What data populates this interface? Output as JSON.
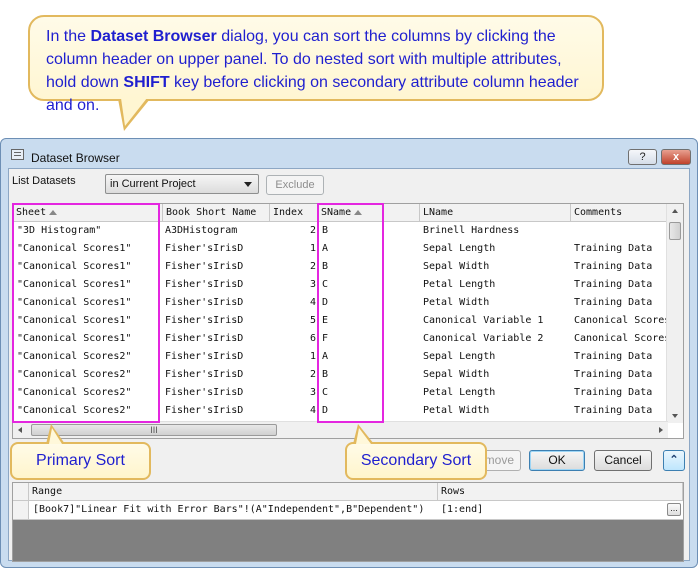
{
  "callout": {
    "t1": "In the ",
    "b1": "Dataset Browser",
    "t2": " dialog, you can sort the columns by clicking the column header on upper panel. To do nested sort with multiple attributes, hold down ",
    "b2": "SHIFT",
    "t3": " key before clicking on secondary attribute column header and on."
  },
  "window": {
    "title": "Dataset Browser",
    "help_label": "?",
    "close_label": "x"
  },
  "controls": {
    "list_datasets_label": "List Datasets",
    "scope_value": "in Current Project",
    "exclude_label": "Exclude"
  },
  "grid": {
    "columns": [
      "Sheet",
      "Book Short Name",
      "Index",
      "SName",
      "LName",
      "Comments"
    ],
    "rows": [
      [
        "\"3D Histogram\"",
        "A3DHistogram",
        "2",
        "B",
        "Brinell Hardness",
        ""
      ],
      [
        "\"Canonical Scores1\"",
        "Fisher'sIrisD",
        "1",
        "A",
        "Sepal Length",
        "Training Data"
      ],
      [
        "\"Canonical Scores1\"",
        "Fisher'sIrisD",
        "2",
        "B",
        "Sepal Width",
        "Training Data"
      ],
      [
        "\"Canonical Scores1\"",
        "Fisher'sIrisD",
        "3",
        "C",
        "Petal Length",
        "Training Data"
      ],
      [
        "\"Canonical Scores1\"",
        "Fisher'sIrisD",
        "4",
        "D",
        "Petal Width",
        "Training Data"
      ],
      [
        "\"Canonical Scores1\"",
        "Fisher'sIrisD",
        "5",
        "E",
        "Canonical Variable 1",
        "Canonical Scores"
      ],
      [
        "\"Canonical Scores1\"",
        "Fisher'sIrisD",
        "6",
        "F",
        "Canonical Variable 2",
        "Canonical Scores"
      ],
      [
        "\"Canonical Scores2\"",
        "Fisher'sIrisD",
        "1",
        "A",
        "Sepal Length",
        "Training Data"
      ],
      [
        "\"Canonical Scores2\"",
        "Fisher'sIrisD",
        "2",
        "B",
        "Sepal Width",
        "Training Data"
      ],
      [
        "\"Canonical Scores2\"",
        "Fisher'sIrisD",
        "3",
        "C",
        "Petal Length",
        "Training Data"
      ],
      [
        "\"Canonical Scores2\"",
        "Fisher'sIrisD",
        "4",
        "D",
        "Petal Width",
        "Training Data"
      ]
    ],
    "hscroll_grip": "III"
  },
  "buttons": {
    "remove_label": "move",
    "ok_label": "OK",
    "cancel_label": "Cancel",
    "expand_label": "⌃"
  },
  "lower_grid": {
    "columns": [
      "Range",
      "Rows"
    ],
    "row": {
      "range": "[Book7]\"Linear Fit with Error Bars\"!(A\"Independent\",B\"Dependent\")",
      "rows": "[1:end]",
      "ellipsis": "..."
    }
  },
  "annotations": {
    "primary": "Primary Sort",
    "secondary": "Secondary Sort"
  },
  "colors": {
    "callout_text": "#1f1fcf",
    "callout_border": "#e2b95e",
    "highlight": "#e426e0"
  }
}
